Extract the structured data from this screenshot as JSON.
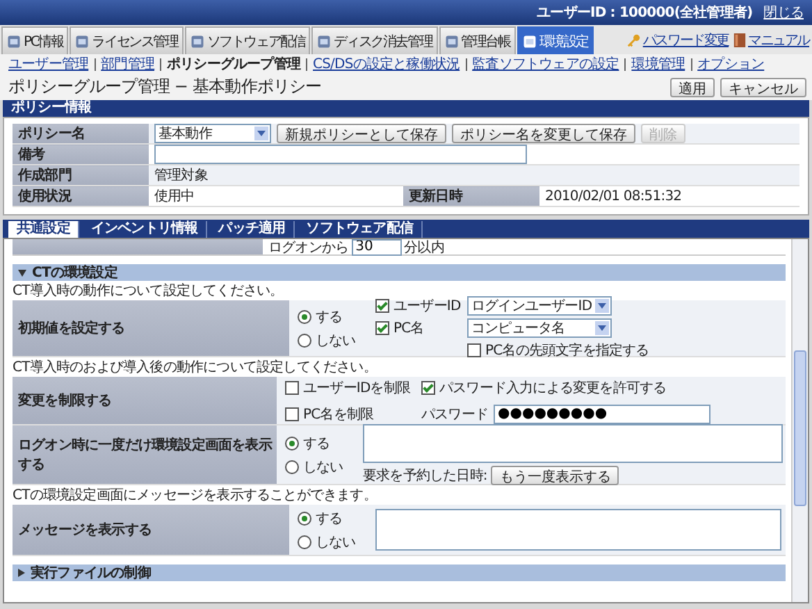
{
  "header": {
    "user": "ユーザーID : 100000(全社管理者)",
    "logout": "閉じる"
  },
  "main_tabs": [
    {
      "label": "PC情報",
      "selected": false
    },
    {
      "label": "ライセンス管理",
      "selected": false
    },
    {
      "label": "ソフトウェア配信",
      "selected": false
    },
    {
      "label": "ディスク消去管理",
      "selected": false
    },
    {
      "label": "管理台帳",
      "selected": false
    },
    {
      "label": "環境設定",
      "selected": true
    }
  ],
  "right_links": [
    {
      "label": "パスワード変更",
      "kind": "key"
    },
    {
      "label": "マニュアル",
      "kind": "book"
    }
  ],
  "sub_nav": [
    {
      "label": "ユーザー管理",
      "selected": false
    },
    {
      "label": "部門管理",
      "selected": false
    },
    {
      "label": "ポリシーグループ管理",
      "selected": true
    },
    {
      "label": "CS/DSの設定と稼働状況",
      "selected": false
    },
    {
      "label": "監査ソフトウェアの設定",
      "selected": false
    },
    {
      "label": "環境管理",
      "selected": false
    },
    {
      "label": "オプション",
      "selected": false
    }
  ],
  "page_title": "ポリシーグループ管理 − 基本動作ポリシー",
  "page_buttons": [
    "適用",
    "キャンセル"
  ],
  "policy_info": {
    "title": "ポリシー情報",
    "name_label": "ポリシー名",
    "name_value": "基本動作",
    "buttons": [
      {
        "label": "新規ポリシーとして保存",
        "disabled": false
      },
      {
        "label": "ポリシー名を変更して保存",
        "disabled": false
      },
      {
        "label": "削除",
        "disabled": true
      }
    ],
    "note_label": "備考",
    "dept_label": "作成部門",
    "dept_value": "管理対象",
    "status_label": "使用状況",
    "status_value": "使用中",
    "updated_label": "更新日時",
    "updated_value": "2010/02/01 08:51:32"
  },
  "sub_tabs": [
    {
      "label": "共通設定",
      "selected": true
    },
    {
      "label": "インベントリ情報",
      "selected": false
    },
    {
      "label": "パッチ適用",
      "selected": false
    },
    {
      "label": "ソフトウェア配信",
      "selected": false
    }
  ],
  "partial_row": {
    "prefix": "ログオンから",
    "value": "30",
    "suffix": "分以内"
  },
  "ct_section": {
    "title": "CTの環境設定",
    "expanded": true,
    "intro1": "CT導入時の動作について設定してください。",
    "initial": {
      "label": "初期値を設定する",
      "options": [
        {
          "label": "する",
          "selected": true
        },
        {
          "label": "しない",
          "selected": false
        }
      ],
      "fields": [
        {
          "label": "ユーザーID",
          "checked": true,
          "value": "ログインユーザーID"
        },
        {
          "label": "PC名",
          "checked": true,
          "value": "コンピュータ名"
        }
      ],
      "prefix_check": {
        "label": "PC名の先頭文字を指定する",
        "checked": false
      }
    },
    "intro2": "CT導入時のおよび導入後の動作について設定してください。",
    "restrict": {
      "label": "変更を制限する",
      "checks": [
        {
          "label": "ユーザーIDを制限",
          "checked": false
        },
        {
          "label": "パスワード入力による変更を許可する",
          "checked": true
        },
        {
          "label": "PC名を制限",
          "checked": false
        }
      ],
      "password_label": "パスワード",
      "password_value": "●●●●●●●●●"
    },
    "logon": {
      "label": "ログオン時に一度だけ環境設定画面を表示する",
      "options": [
        {
          "label": "する",
          "selected": true
        },
        {
          "label": "しない",
          "selected": false
        }
      ],
      "requested_label": "要求を予約した日時:",
      "button": "もう一度表示する"
    },
    "intro3": "CTの環境設定画面にメッセージを表示することができます。",
    "message": {
      "label": "メッセージを表示する",
      "options": [
        {
          "label": "する",
          "selected": true
        },
        {
          "label": "しない",
          "selected": false
        }
      ]
    }
  },
  "exec_section": {
    "title": "実行ファイルの制御",
    "expanded": false
  }
}
